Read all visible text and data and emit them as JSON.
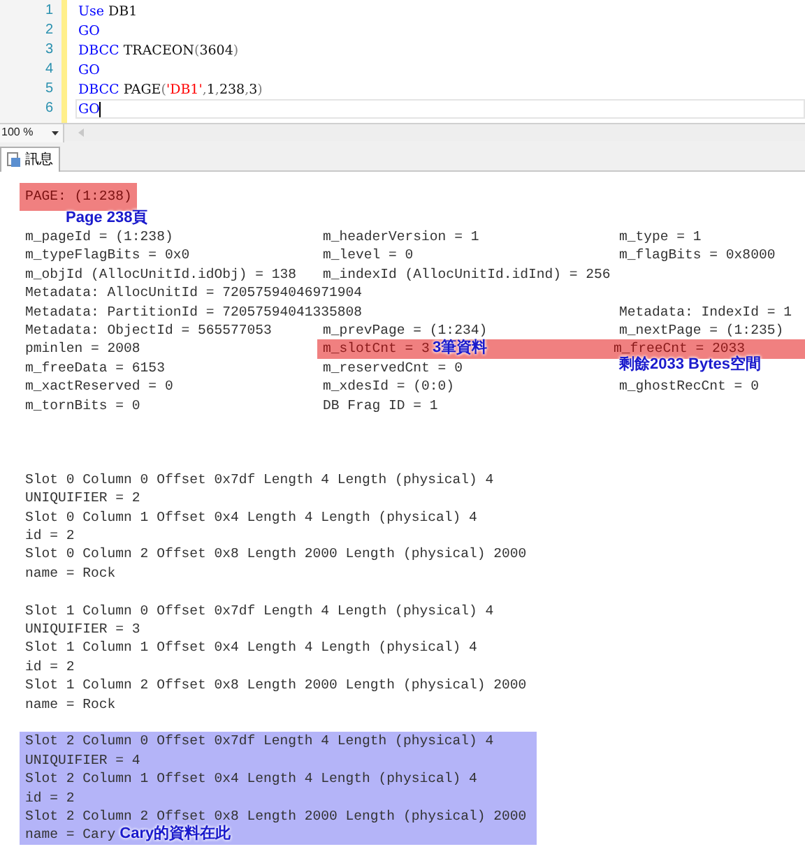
{
  "editor": {
    "lines": [
      {
        "number": "1",
        "current": false,
        "tokens": [
          {
            "text": "Use",
            "kind": "keyword"
          },
          {
            "text": " DB1",
            "kind": "plain"
          }
        ]
      },
      {
        "number": "2",
        "current": false,
        "tokens": [
          {
            "text": "GO",
            "kind": "keyword"
          }
        ]
      },
      {
        "number": "3",
        "current": false,
        "tokens": [
          {
            "text": "DBCC",
            "kind": "keyword"
          },
          {
            "text": " TRACEON",
            "kind": "plain"
          },
          {
            "text": "(",
            "kind": "punct"
          },
          {
            "text": "3604",
            "kind": "plain"
          },
          {
            "text": ")",
            "kind": "punct"
          }
        ]
      },
      {
        "number": "4",
        "current": false,
        "tokens": [
          {
            "text": "GO",
            "kind": "keyword"
          }
        ]
      },
      {
        "number": "5",
        "current": false,
        "tokens": [
          {
            "text": "DBCC",
            "kind": "keyword"
          },
          {
            "text": " PAGE",
            "kind": "plain"
          },
          {
            "text": "(",
            "kind": "punct"
          },
          {
            "text": "'DB1'",
            "kind": "string"
          },
          {
            "text": ",",
            "kind": "punct"
          },
          {
            "text": "1",
            "kind": "plain"
          },
          {
            "text": ",",
            "kind": "punct"
          },
          {
            "text": "238",
            "kind": "plain"
          },
          {
            "text": ",",
            "kind": "punct"
          },
          {
            "text": "3",
            "kind": "plain"
          },
          {
            "text": ")",
            "kind": "punct"
          }
        ]
      },
      {
        "number": "6",
        "current": true,
        "tokens": [
          {
            "text": "GO",
            "kind": "keyword"
          }
        ]
      }
    ]
  },
  "zoom": "100 %",
  "tabs": [
    {
      "label": "訊息",
      "selected": true
    }
  ],
  "output": {
    "page": {
      "text": "PAGE: (1:238)",
      "highlighted": true,
      "note": "Page 238頁"
    },
    "header_rows": [
      {
        "highlighted": false,
        "cells": [
          {
            "text": "m_pageId = (1:238)",
            "kind": "field"
          },
          {
            "text": "m_headerVersion = 1",
            "kind": "field"
          },
          {
            "text": "m_type = 1",
            "kind": "field"
          }
        ]
      },
      {
        "highlighted": false,
        "cells": [
          {
            "text": "m_typeFlagBits = 0x0",
            "kind": "field"
          },
          {
            "text": "m_level = 0",
            "kind": "field"
          },
          {
            "text": "m_flagBits = 0x8000",
            "kind": "field"
          }
        ]
      },
      {
        "highlighted": false,
        "cells": [
          {
            "text": "m_objId (AllocUnitId.idObj) = 138",
            "kind": "field"
          },
          {
            "text": "m_indexId (AllocUnitId.idInd) = 256",
            "kind": "field"
          }
        ]
      },
      {
        "highlighted": false,
        "cells": [
          {
            "text": "Metadata: AllocUnitId = 72057594046971904",
            "kind": "field"
          }
        ]
      },
      {
        "highlighted": false,
        "cells": [
          {
            "text": "Metadata: PartitionId = 72057594041335808",
            "kind": "field"
          },
          {
            "text": "",
            "kind": "blank"
          },
          {
            "text": "Metadata: IndexId = 1",
            "kind": "field"
          }
        ]
      },
      {
        "highlighted": false,
        "cells": [
          {
            "text": "Metadata: ObjectId = 565577053",
            "kind": "field"
          },
          {
            "text": "m_prevPage = (1:234)",
            "kind": "field"
          },
          {
            "text": "m_nextPage = (1:235)",
            "kind": "field"
          }
        ]
      },
      {
        "highlighted": true,
        "cells": [
          {
            "text": "pminlen = 2008",
            "kind": "field"
          },
          {
            "text": "m_slotCnt = 3",
            "kind": "field",
            "note": "3筆資料"
          },
          {
            "text": "m_freeCnt = 2033",
            "kind": "field"
          }
        ]
      },
      {
        "highlighted": false,
        "cells": [
          {
            "text": "m_freeData = 6153",
            "kind": "field"
          },
          {
            "text": "m_reservedCnt = 0",
            "kind": "field"
          },
          {
            "text": "剩餘2033 Bytes空間",
            "kind": "note"
          }
        ]
      },
      {
        "highlighted": false,
        "cells": [
          {
            "text": "m_xactReserved = 0",
            "kind": "field"
          },
          {
            "text": "m_xdesId = (0:0)",
            "kind": "field"
          },
          {
            "text": "m_ghostRecCnt = 0",
            "kind": "field"
          }
        ]
      },
      {
        "highlighted": false,
        "cells": [
          {
            "text": "m_tornBits = 0",
            "kind": "field"
          },
          {
            "text": "DB Frag ID = 1",
            "kind": "field"
          }
        ]
      }
    ],
    "slots": [
      {
        "highlighted": false,
        "lines": [
          {
            "text": "Slot 0 Column 0 Offset 0x7df Length 4 Length (physical) 4"
          },
          {
            "text": "UNIQUIFIER = 2"
          },
          {
            "text": "Slot 0 Column 1 Offset 0x4 Length 4 Length (physical) 4"
          },
          {
            "text": "id = 2"
          },
          {
            "text": "Slot 0 Column 2 Offset 0x8 Length 2000 Length (physical) 2000"
          },
          {
            "text": "name = Rock"
          }
        ]
      },
      {
        "highlighted": false,
        "lines": [
          {
            "text": "Slot 1 Column 0 Offset 0x7df Length 4 Length (physical) 4"
          },
          {
            "text": "UNIQUIFIER = 3"
          },
          {
            "text": "Slot 1 Column 1 Offset 0x4 Length 4 Length (physical) 4"
          },
          {
            "text": "id = 2"
          },
          {
            "text": "Slot 1 Column 2 Offset 0x8 Length 2000 Length (physical) 2000"
          },
          {
            "text": "name = Rock"
          }
        ]
      },
      {
        "highlighted": true,
        "lines": [
          {
            "text": "Slot 2 Column 0 Offset 0x7df Length 4 Length (physical) 4"
          },
          {
            "text": "UNIQUIFIER = 4"
          },
          {
            "text": "Slot 2 Column 1 Offset 0x4 Length 4 Length (physical) 4"
          },
          {
            "text": "id = 2"
          },
          {
            "text": "Slot 2 Column 2 Offset 0x8 Length 2000 Length (physical) 2000"
          },
          {
            "text": "name = Cary",
            "note": "Cary的資料在此"
          }
        ]
      }
    ]
  }
}
